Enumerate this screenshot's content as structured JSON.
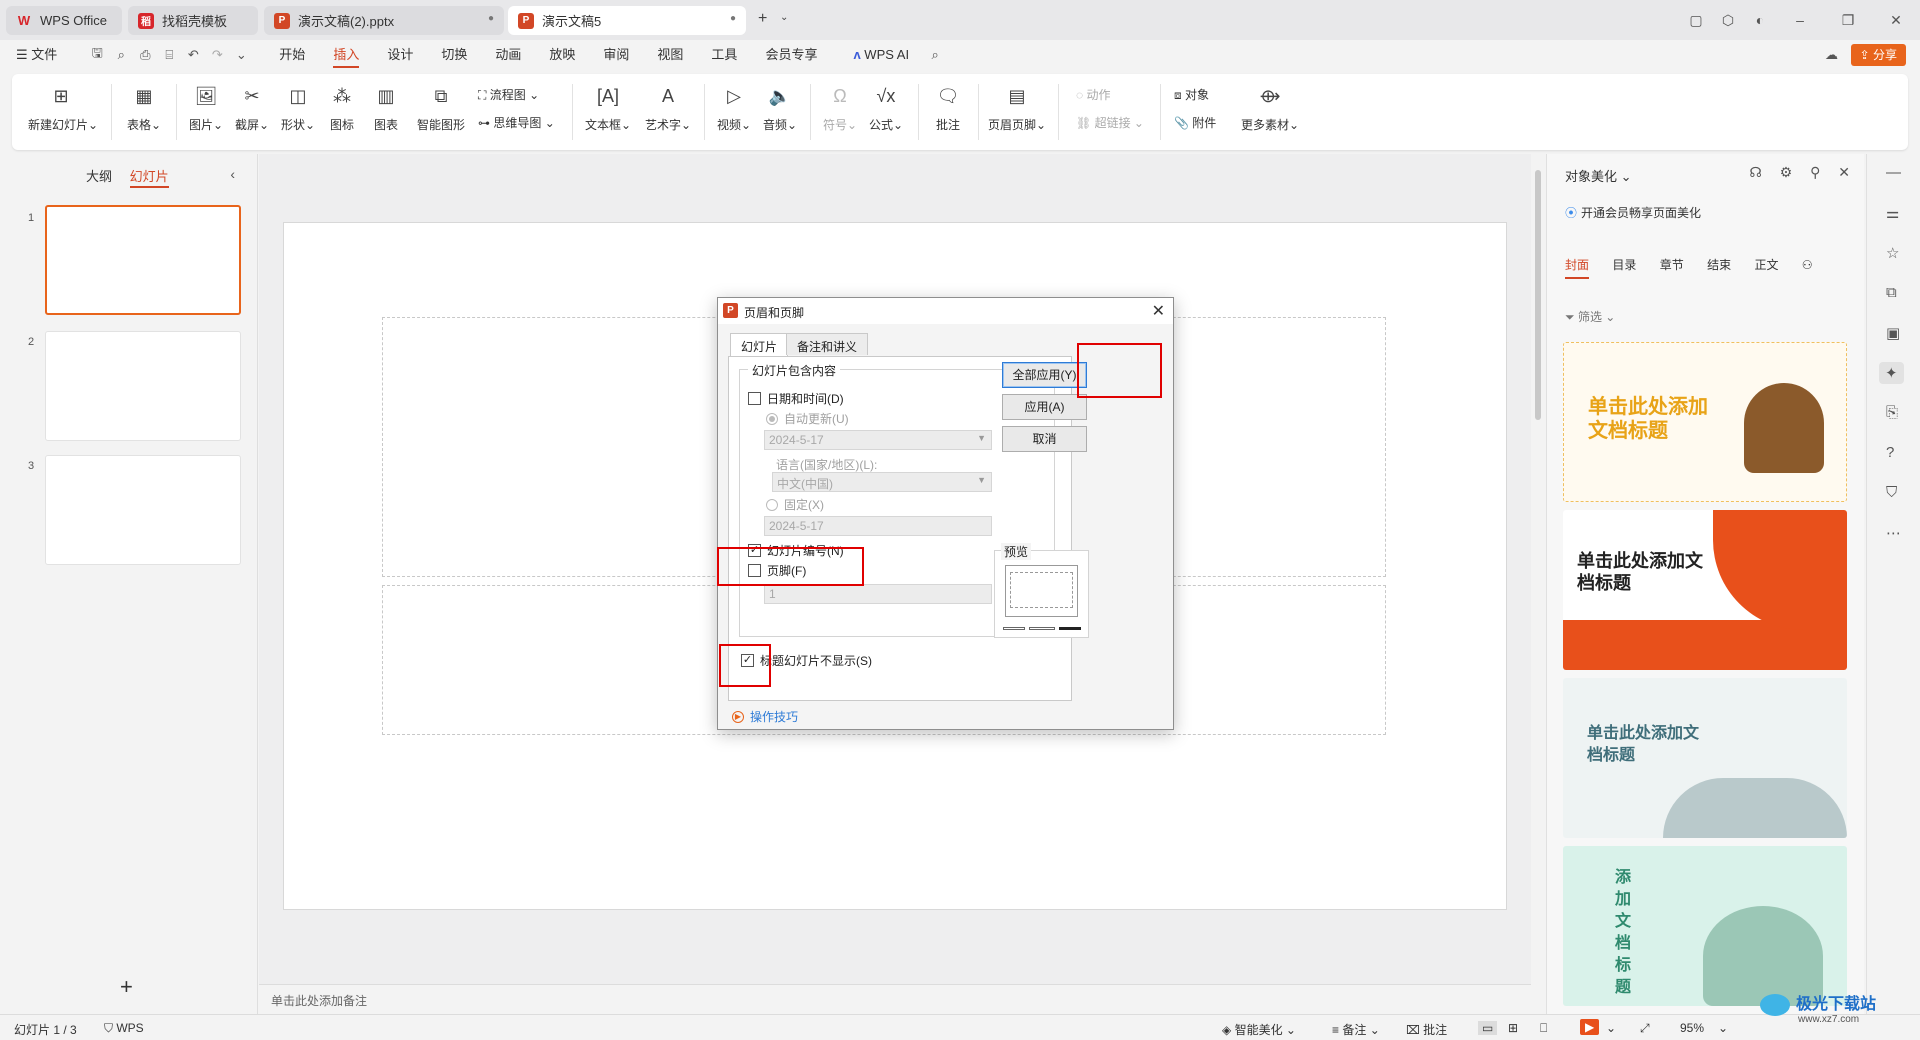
{
  "tabs": [
    {
      "label": "WPS Office",
      "icon": "wps-logo-icon"
    },
    {
      "label": "找稻壳模板",
      "icon": "docer-icon"
    },
    {
      "label": "演示文稿(2).pptx",
      "icon": "ppt-file-icon"
    },
    {
      "label": "演示文稿5",
      "icon": "ppt-file-icon"
    }
  ],
  "menu": {
    "file": "文件",
    "items": [
      "开始",
      "插入",
      "设计",
      "切换",
      "动画",
      "放映",
      "审阅",
      "视图",
      "工具",
      "会员专享"
    ],
    "active": "插入",
    "wps_ai": "WPS AI",
    "share": "分享"
  },
  "ribbon": {
    "new_slide": "新建幻灯片",
    "table": "表格",
    "picture": "图片",
    "screenshot": "截屏",
    "shape": "形状",
    "icon": "图标",
    "chart": "图表",
    "smart_graphic": "智能图形",
    "flowchart": "流程图",
    "mindmap": "思维导图",
    "textbox": "文本框",
    "wordart": "艺术字",
    "video": "视频",
    "audio": "音频",
    "symbol": "符号",
    "formula": "公式",
    "comment": "批注",
    "header_footer": "页眉页脚",
    "action": "动作",
    "hyperlink": "超链接",
    "object": "对象",
    "attachment": "附件",
    "more_material": "更多素材"
  },
  "left_panel": {
    "tab_outline": "大纲",
    "tab_slides": "幻灯片",
    "slide_numbers": [
      "1",
      "2",
      "3"
    ]
  },
  "notes_placeholder": "单击此处添加备注",
  "right_panel": {
    "title": "对象美化",
    "vip": "开通会员畅享页面美化",
    "tabs": [
      "封面",
      "目录",
      "章节",
      "结束",
      "正文"
    ],
    "filter": "筛选",
    "templates": [
      {
        "title": "单击此处添加文档标题",
        "accent": "#e8a317"
      },
      {
        "title": "单击此处添加文档标题",
        "accent": "#e8501b"
      },
      {
        "title": "单击此处添加文档标题",
        "accent": "#3f6e7a"
      },
      {
        "title": "添加文档标题",
        "accent": "#2f8a6e"
      }
    ]
  },
  "status": {
    "slide_count": "幻灯片 1 / 3",
    "theme": "WPS",
    "smart_beautify": "智能美化",
    "notes": "备注",
    "comment": "批注",
    "zoom": "95%"
  },
  "dialog": {
    "title": "页眉和页脚",
    "tab_slide": "幻灯片",
    "tab_notes": "备注和讲义",
    "group_title": "幻灯片包含内容",
    "date_time": "日期和时间(D)",
    "auto_update": "自动更新(U)",
    "auto_date": "2024-5-17",
    "language_label": "语言(国家/地区)(L):",
    "language_value": "中文(中国)",
    "fixed": "固定(X)",
    "fixed_date": "2024-5-17",
    "slide_number": "幻灯片编号(N)",
    "footer": "页脚(F)",
    "footer_value": "1",
    "hide_title": "标题幻灯片不显示(S)",
    "apply_all": "全部应用(Y)",
    "apply": "应用(A)",
    "cancel": "取消",
    "preview": "预览",
    "tips": "操作技巧",
    "checked": {
      "date_time": false,
      "slide_number": true,
      "footer": false,
      "hide_title": true
    }
  },
  "watermark": {
    "name": "极光下载站",
    "url": "www.xz7.com"
  }
}
